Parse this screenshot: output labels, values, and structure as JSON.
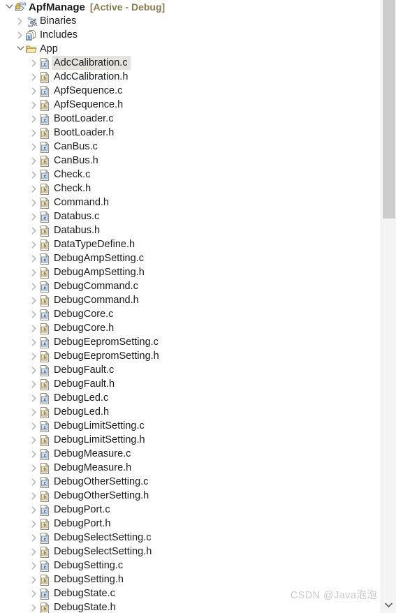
{
  "project": {
    "name": "ApfManage",
    "build_config": "[Active - Debug]",
    "icon": "ccs-project-icon",
    "expanded": true,
    "accent_build_color": "#8a7c4e"
  },
  "tree": {
    "rows": [
      {
        "label": "ApfManage",
        "suffix": "[Active - Debug]",
        "icon": "ccs-project-icon",
        "level": 0,
        "twisty": "chevron-down",
        "bold": true,
        "selected": false
      },
      {
        "label": "Binaries",
        "suffix": "",
        "icon": "binaries-icon",
        "level": 1,
        "twisty": "chevron-right",
        "bold": false,
        "selected": false
      },
      {
        "label": "Includes",
        "suffix": "",
        "icon": "includes-icon",
        "level": 1,
        "twisty": "chevron-right",
        "bold": false,
        "selected": false
      },
      {
        "label": "App",
        "suffix": "",
        "icon": "folder-icon",
        "level": 1,
        "twisty": "chevron-down",
        "bold": false,
        "selected": false
      },
      {
        "label": "AdcCalibration.c",
        "suffix": "",
        "icon": "c-file-icon",
        "level": 2,
        "twisty": "chevron-right",
        "bold": false,
        "selected": true
      },
      {
        "label": "AdcCalibration.h",
        "suffix": "",
        "icon": "h-file-icon",
        "level": 2,
        "twisty": "chevron-right",
        "bold": false,
        "selected": false
      },
      {
        "label": "ApfSequence.c",
        "suffix": "",
        "icon": "c-file-icon",
        "level": 2,
        "twisty": "chevron-right",
        "bold": false,
        "selected": false
      },
      {
        "label": "ApfSequence.h",
        "suffix": "",
        "icon": "h-file-icon",
        "level": 2,
        "twisty": "chevron-right",
        "bold": false,
        "selected": false
      },
      {
        "label": "BootLoader.c",
        "suffix": "",
        "icon": "c-file-icon",
        "level": 2,
        "twisty": "chevron-right",
        "bold": false,
        "selected": false
      },
      {
        "label": "BootLoader.h",
        "suffix": "",
        "icon": "h-file-icon",
        "level": 2,
        "twisty": "chevron-right",
        "bold": false,
        "selected": false
      },
      {
        "label": "CanBus.c",
        "suffix": "",
        "icon": "c-file-icon",
        "level": 2,
        "twisty": "chevron-right",
        "bold": false,
        "selected": false
      },
      {
        "label": "CanBus.h",
        "suffix": "",
        "icon": "h-file-icon",
        "level": 2,
        "twisty": "chevron-right",
        "bold": false,
        "selected": false
      },
      {
        "label": "Check.c",
        "suffix": "",
        "icon": "c-file-icon",
        "level": 2,
        "twisty": "chevron-right",
        "bold": false,
        "selected": false
      },
      {
        "label": "Check.h",
        "suffix": "",
        "icon": "h-file-icon",
        "level": 2,
        "twisty": "chevron-right",
        "bold": false,
        "selected": false
      },
      {
        "label": "Command.h",
        "suffix": "",
        "icon": "h-file-icon",
        "level": 2,
        "twisty": "chevron-right",
        "bold": false,
        "selected": false
      },
      {
        "label": "Databus.c",
        "suffix": "",
        "icon": "c-file-icon",
        "level": 2,
        "twisty": "chevron-right",
        "bold": false,
        "selected": false
      },
      {
        "label": "Databus.h",
        "suffix": "",
        "icon": "h-file-icon",
        "level": 2,
        "twisty": "chevron-right",
        "bold": false,
        "selected": false
      },
      {
        "label": "DataTypeDefine.h",
        "suffix": "",
        "icon": "h-file-icon",
        "level": 2,
        "twisty": "chevron-right",
        "bold": false,
        "selected": false
      },
      {
        "label": "DebugAmpSetting.c",
        "suffix": "",
        "icon": "c-file-icon",
        "level": 2,
        "twisty": "chevron-right",
        "bold": false,
        "selected": false
      },
      {
        "label": "DebugAmpSetting.h",
        "suffix": "",
        "icon": "h-file-icon",
        "level": 2,
        "twisty": "chevron-right",
        "bold": false,
        "selected": false
      },
      {
        "label": "DebugCommand.c",
        "suffix": "",
        "icon": "c-file-icon",
        "level": 2,
        "twisty": "chevron-right",
        "bold": false,
        "selected": false
      },
      {
        "label": "DebugCommand.h",
        "suffix": "",
        "icon": "h-file-icon",
        "level": 2,
        "twisty": "chevron-right",
        "bold": false,
        "selected": false
      },
      {
        "label": "DebugCore.c",
        "suffix": "",
        "icon": "c-file-icon",
        "level": 2,
        "twisty": "chevron-right",
        "bold": false,
        "selected": false
      },
      {
        "label": "DebugCore.h",
        "suffix": "",
        "icon": "h-file-icon",
        "level": 2,
        "twisty": "chevron-right",
        "bold": false,
        "selected": false
      },
      {
        "label": "DebugEepromSetting.c",
        "suffix": "",
        "icon": "c-file-icon",
        "level": 2,
        "twisty": "chevron-right",
        "bold": false,
        "selected": false
      },
      {
        "label": "DebugEepromSetting.h",
        "suffix": "",
        "icon": "h-file-icon",
        "level": 2,
        "twisty": "chevron-right",
        "bold": false,
        "selected": false
      },
      {
        "label": "DebugFault.c",
        "suffix": "",
        "icon": "c-file-icon",
        "level": 2,
        "twisty": "chevron-right",
        "bold": false,
        "selected": false
      },
      {
        "label": "DebugFault.h",
        "suffix": "",
        "icon": "h-file-icon",
        "level": 2,
        "twisty": "chevron-right",
        "bold": false,
        "selected": false
      },
      {
        "label": "DebugLed.c",
        "suffix": "",
        "icon": "c-file-icon",
        "level": 2,
        "twisty": "chevron-right",
        "bold": false,
        "selected": false
      },
      {
        "label": "DebugLed.h",
        "suffix": "",
        "icon": "h-file-icon",
        "level": 2,
        "twisty": "chevron-right",
        "bold": false,
        "selected": false
      },
      {
        "label": "DebugLimitSetting.c",
        "suffix": "",
        "icon": "c-file-icon",
        "level": 2,
        "twisty": "chevron-right",
        "bold": false,
        "selected": false
      },
      {
        "label": "DebugLimitSetting.h",
        "suffix": "",
        "icon": "h-file-icon",
        "level": 2,
        "twisty": "chevron-right",
        "bold": false,
        "selected": false
      },
      {
        "label": "DebugMeasure.c",
        "suffix": "",
        "icon": "c-file-icon",
        "level": 2,
        "twisty": "chevron-right",
        "bold": false,
        "selected": false
      },
      {
        "label": "DebugMeasure.h",
        "suffix": "",
        "icon": "h-file-icon",
        "level": 2,
        "twisty": "chevron-right",
        "bold": false,
        "selected": false
      },
      {
        "label": "DebugOtherSetting.c",
        "suffix": "",
        "icon": "c-file-icon",
        "level": 2,
        "twisty": "chevron-right",
        "bold": false,
        "selected": false
      },
      {
        "label": "DebugOtherSetting.h",
        "suffix": "",
        "icon": "h-file-icon",
        "level": 2,
        "twisty": "chevron-right",
        "bold": false,
        "selected": false
      },
      {
        "label": "DebugPort.c",
        "suffix": "",
        "icon": "c-file-icon",
        "level": 2,
        "twisty": "chevron-right",
        "bold": false,
        "selected": false
      },
      {
        "label": "DebugPort.h",
        "suffix": "",
        "icon": "h-file-icon",
        "level": 2,
        "twisty": "chevron-right",
        "bold": false,
        "selected": false
      },
      {
        "label": "DebugSelectSetting.c",
        "suffix": "",
        "icon": "c-file-icon",
        "level": 2,
        "twisty": "chevron-right",
        "bold": false,
        "selected": false
      },
      {
        "label": "DebugSelectSetting.h",
        "suffix": "",
        "icon": "h-file-icon",
        "level": 2,
        "twisty": "chevron-right",
        "bold": false,
        "selected": false
      },
      {
        "label": "DebugSetting.c",
        "suffix": "",
        "icon": "c-file-icon",
        "level": 2,
        "twisty": "chevron-right",
        "bold": false,
        "selected": false
      },
      {
        "label": "DebugSetting.h",
        "suffix": "",
        "icon": "h-file-icon",
        "level": 2,
        "twisty": "chevron-right",
        "bold": false,
        "selected": false
      },
      {
        "label": "DebugState.c",
        "suffix": "",
        "icon": "c-file-icon",
        "level": 2,
        "twisty": "chevron-right",
        "bold": false,
        "selected": false
      },
      {
        "label": "DebugState.h",
        "suffix": "",
        "icon": "h-file-icon",
        "level": 2,
        "twisty": "chevron-right",
        "bold": false,
        "selected": false
      }
    ]
  },
  "scrollbar": {
    "orientation": "vertical",
    "thumb_top": 0,
    "thumb_height": 313,
    "track_color": "#f4f4f4",
    "thumb_color": "#cdcdcd",
    "down_arrow_icon": "chevron-down-icon"
  },
  "watermark": {
    "text": "CSDN @Java泡泡",
    "color": "#c9c9c9"
  }
}
